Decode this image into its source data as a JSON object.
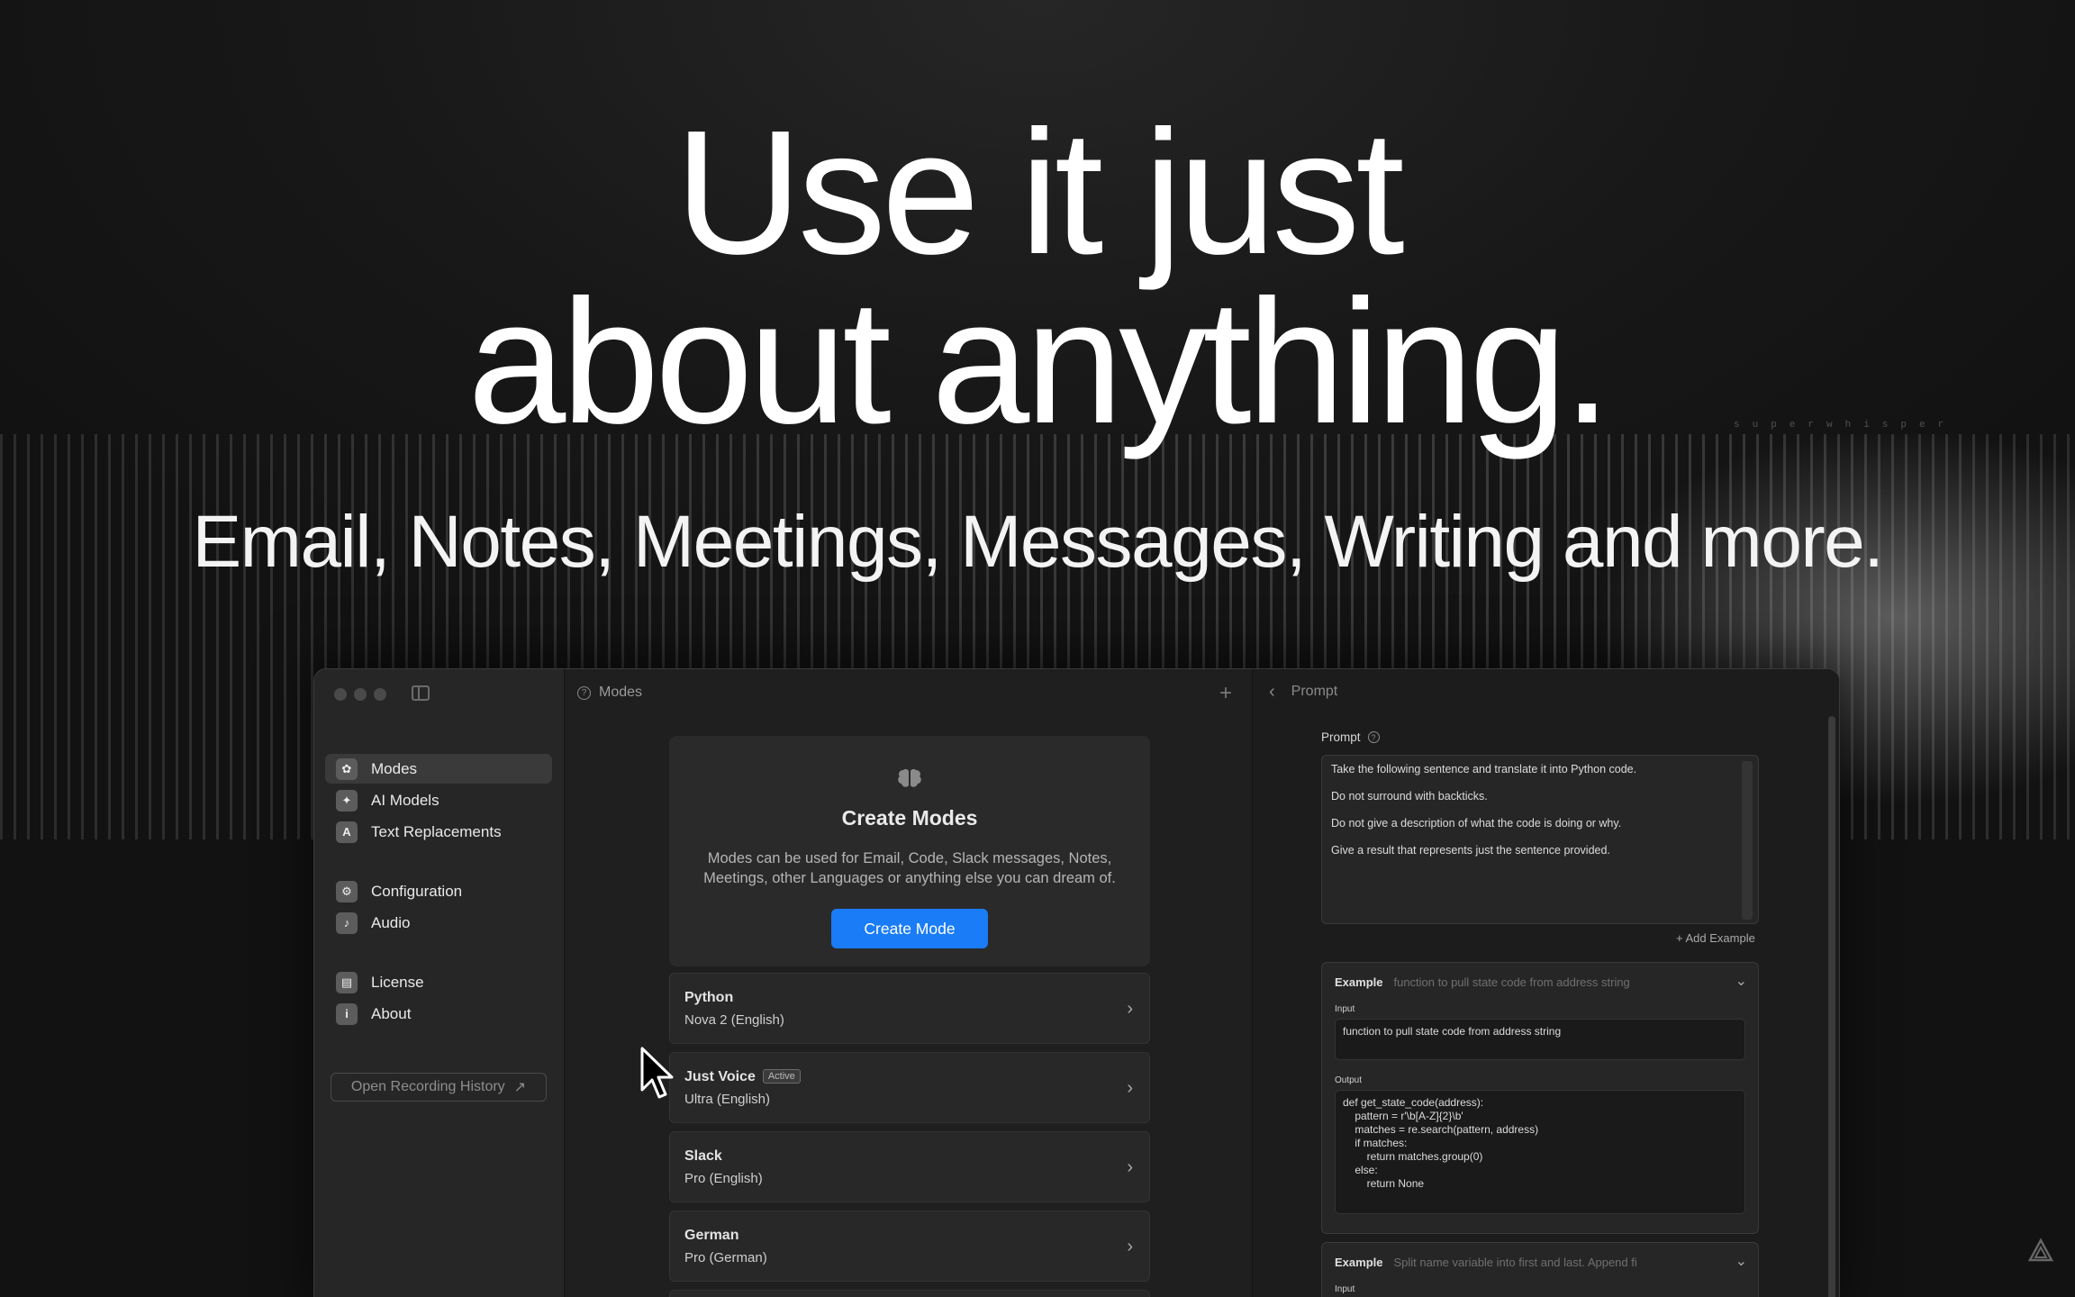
{
  "hero": {
    "title_line1": "Use it just",
    "title_line2": "about anything.",
    "subtitle": "Email, Notes, Meetings, Messages, Writing and more.",
    "watermark": "superwhisper"
  },
  "colors": {
    "accent": "#1a7cf6",
    "background": "#161616",
    "window": "#1f1f1f"
  },
  "sidebar": {
    "items": [
      {
        "label": "Modes",
        "icon": "brain-icon",
        "active": true
      },
      {
        "label": "AI Models",
        "icon": "sparkle-icon",
        "active": false
      },
      {
        "label": "Text Replacements",
        "icon": "text-replace-icon",
        "active": false
      },
      {
        "label": "Configuration",
        "icon": "gear-icon",
        "active": false
      },
      {
        "label": "Audio",
        "icon": "speaker-icon",
        "active": false
      },
      {
        "label": "License",
        "icon": "license-icon",
        "active": false
      },
      {
        "label": "About",
        "icon": "info-icon",
        "active": false
      }
    ],
    "history_button": "Open Recording History"
  },
  "modes": {
    "header": "Modes",
    "create_title": "Create Modes",
    "create_description": "Modes can be used for Email, Code, Slack messages, Notes, Meetings, other Languages or anything else you can dream of.",
    "create_button": "Create Mode",
    "list": [
      {
        "name": "Python",
        "model": "Nova 2 (English)",
        "badge": ""
      },
      {
        "name": "Just Voice",
        "model": "Ultra (English)",
        "badge": "Active"
      },
      {
        "name": "Slack",
        "model": "Pro (English)",
        "badge": ""
      },
      {
        "name": "German",
        "model": "Pro (German)",
        "badge": ""
      }
    ]
  },
  "prompt": {
    "header": "Prompt",
    "label": "Prompt",
    "lines": [
      "Take the following sentence and translate it into Python code.",
      "Do not surround with backticks.",
      "Do not give a description of what the code is doing or why.",
      "Give a result that represents just the sentence provided."
    ],
    "add_example": "Add Example",
    "examples": [
      {
        "title": "Example",
        "description": "function to pull state code from address string",
        "input_label": "Input",
        "input": "function to pull state code from address string",
        "output_label": "Output",
        "output_lines": [
          "def get_state_code(address):",
          "    pattern = r'\\b[A-Z]{2}\\b'",
          "    matches = re.search(pattern, address)",
          "    if matches:",
          "        return matches.group(0)",
          "    else:",
          "        return None"
        ]
      },
      {
        "title": "Example",
        "description": "Split name variable into first and last. Append fi",
        "input_label": "Input"
      }
    ]
  }
}
